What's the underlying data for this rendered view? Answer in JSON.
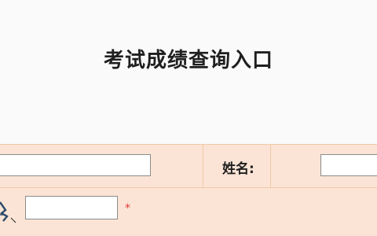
{
  "page": {
    "title": "考试成绩查询入口"
  },
  "form": {
    "name_label": "姓名:",
    "required_mark": "*",
    "fields": {
      "id_number": {
        "value": ""
      },
      "name": {
        "value": ""
      },
      "captcha": {
        "value": ""
      }
    }
  },
  "colors": {
    "row_background": "#fbe4d5",
    "border": "#f0c8a9",
    "required": "#e23b3b"
  },
  "icons": {
    "captcha": "captcha-image-icon"
  }
}
